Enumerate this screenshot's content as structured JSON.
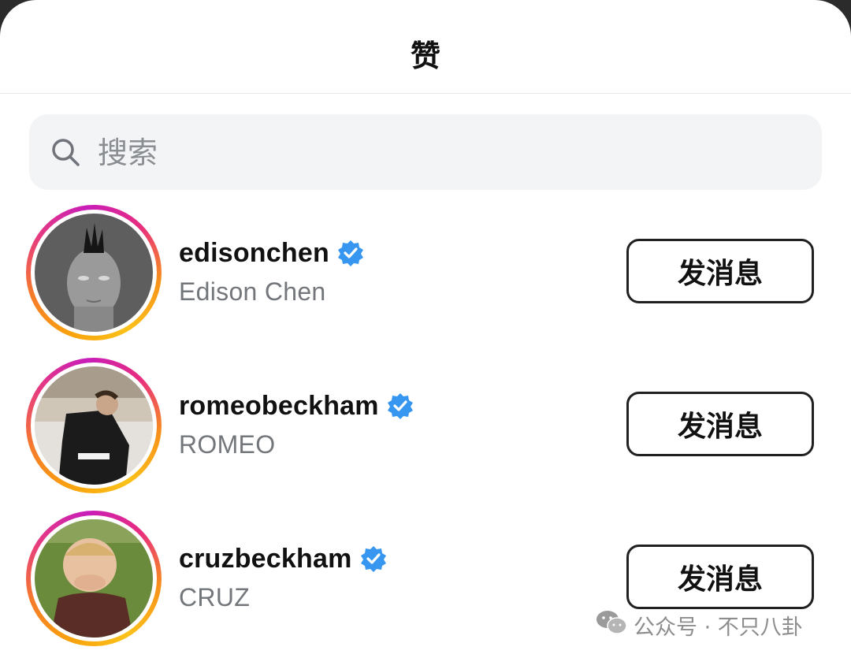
{
  "header": {
    "title": "赞"
  },
  "search": {
    "placeholder": "搜索"
  },
  "users": [
    {
      "username": "edisonchen",
      "full_name": "Edison Chen",
      "verified": true,
      "button_label": "发消息"
    },
    {
      "username": "romeobeckham",
      "full_name": "ROMEO",
      "verified": true,
      "button_label": "发消息"
    },
    {
      "username": "cruzbeckham",
      "full_name": "CRUZ",
      "verified": true,
      "button_label": "发消息"
    }
  ],
  "watermark": {
    "text": "公众号 · 不只八卦",
    "icon": "wechat-icon"
  },
  "colors": {
    "verified_badge": "#3797f0",
    "story_ring": [
      "#f9a20b",
      "#e63b80",
      "#c81db9"
    ]
  }
}
